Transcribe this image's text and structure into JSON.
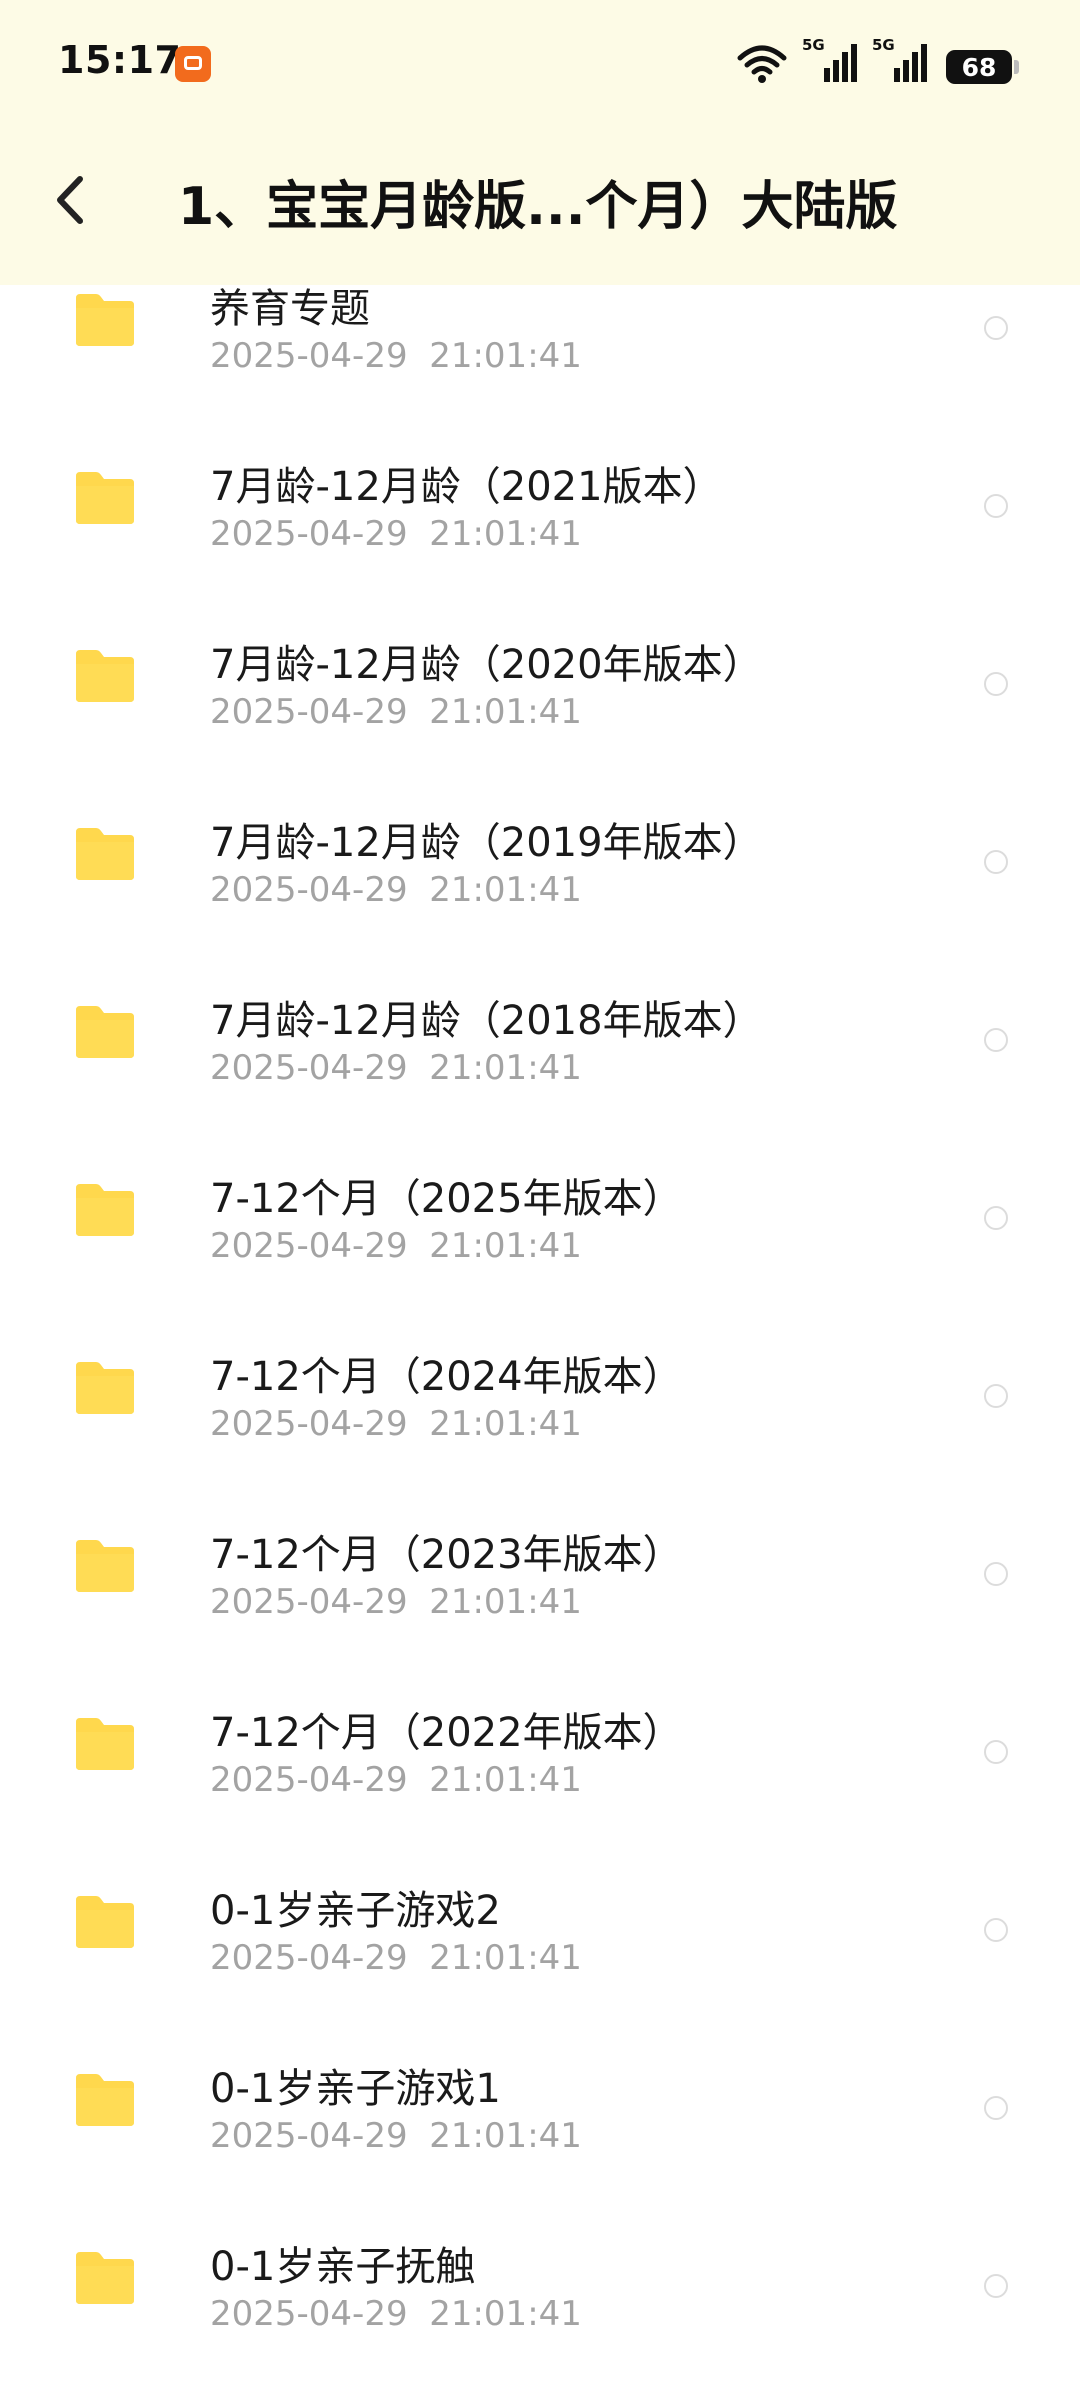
{
  "status_bar": {
    "time": "15:17",
    "network_1": "5G",
    "network_2": "5G",
    "battery": "68"
  },
  "header": {
    "title": "1、宝宝月龄版...个月）大陆版"
  },
  "colors": {
    "header_bg": "#fdfbe6",
    "folder_yellow": "#ffd84d",
    "date_gray": "#a3a3a3"
  },
  "files": [
    {
      "name": "养育专题",
      "date": "2025-04-29  21:01:41",
      "icon": "folder-icon"
    },
    {
      "name": "7月龄-12月龄（2021版本）",
      "date": "2025-04-29  21:01:41",
      "icon": "folder-icon"
    },
    {
      "name": "7月龄-12月龄（2020年版本）",
      "date": "2025-04-29  21:01:41",
      "icon": "folder-icon"
    },
    {
      "name": "7月龄-12月龄（2019年版本）",
      "date": "2025-04-29  21:01:41",
      "icon": "folder-icon"
    },
    {
      "name": "7月龄-12月龄（2018年版本）",
      "date": "2025-04-29  21:01:41",
      "icon": "folder-icon"
    },
    {
      "name": "7-12个月（2025年版本）",
      "date": "2025-04-29  21:01:41",
      "icon": "folder-icon"
    },
    {
      "name": "7-12个月（2024年版本）",
      "date": "2025-04-29  21:01:41",
      "icon": "folder-icon"
    },
    {
      "name": "7-12个月（2023年版本）",
      "date": "2025-04-29  21:01:41",
      "icon": "folder-icon"
    },
    {
      "name": "7-12个月（2022年版本）",
      "date": "2025-04-29  21:01:41",
      "icon": "folder-icon"
    },
    {
      "name": "0-1岁亲子游戏2",
      "date": "2025-04-29  21:01:41",
      "icon": "folder-icon"
    },
    {
      "name": "0-1岁亲子游戏1",
      "date": "2025-04-29  21:01:41",
      "icon": "folder-icon"
    },
    {
      "name": "0-1岁亲子抚触",
      "date": "2025-04-29  21:01:41",
      "icon": "folder-icon"
    }
  ]
}
